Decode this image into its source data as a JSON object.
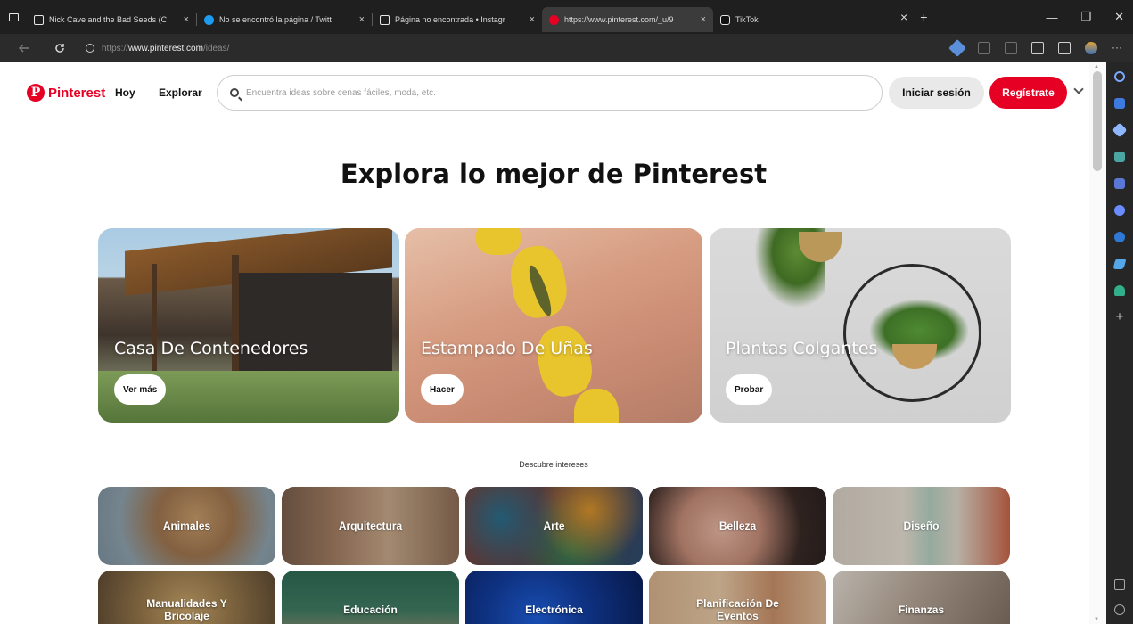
{
  "browser": {
    "tabs": [
      {
        "title": "Nick Cave and the Bad Seeds (C",
        "favicon_color": "#f2f2f2"
      },
      {
        "title": "No se encontró la página / Twitt",
        "favicon_color": "#1d9bf0"
      },
      {
        "title": "Página no encontrada • Instagr",
        "favicon_color": "#f2f2f2"
      },
      {
        "title": "https://www.pinterest.com/_u/9",
        "favicon_color": "#e60023"
      },
      {
        "title": "TikTok",
        "favicon_color": "#f2f2f2"
      }
    ],
    "close_glyph": "×",
    "new_tab_glyph": "+",
    "address": {
      "protocol": "https://",
      "host": "www.pinterest.com",
      "path": "/ideas/"
    },
    "window_controls": {
      "minimize": "—",
      "restore": "❐",
      "close": "✕"
    }
  },
  "header": {
    "brand": "Pinterest",
    "brand_logo_glyph": "P",
    "nav": {
      "home": "Hoy",
      "explore": "Explorar"
    },
    "search_placeholder": "Encuentra ideas sobre cenas fáciles, moda, etc.",
    "login": "Iniciar sesión",
    "signup": "Regístrate"
  },
  "hero": {
    "title": "Explora lo mejor de Pinterest",
    "cards": [
      {
        "title": "Casa De Contenedores",
        "button": "Ver más"
      },
      {
        "title": "Estampado De Uñas",
        "button": "Hacer"
      },
      {
        "title": "Plantas Colgantes",
        "button": "Probar"
      }
    ]
  },
  "interests": {
    "heading": "Descubre intereses",
    "row1": [
      "Animales",
      "Arquitectura",
      "Arte",
      "Belleza",
      "Diseño"
    ],
    "row2": [
      "Manualidades Y Bricolaje",
      "Educación",
      "Electrónica",
      "Planificación De Eventos",
      "Finanzas"
    ]
  },
  "colors": {
    "accent": "#e60023",
    "login_bg": "#e9e9e9"
  },
  "icons": [
    "search-icon",
    "chevron-down-icon",
    "lock-icon",
    "back-icon",
    "refresh-icon",
    "favorites-icon",
    "collections-icon",
    "profile-icon",
    "more-icon"
  ]
}
